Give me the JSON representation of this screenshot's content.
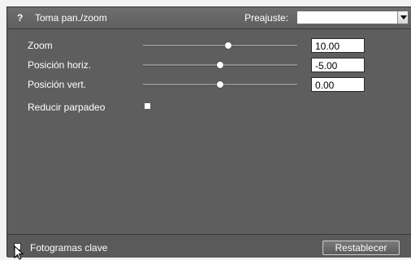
{
  "header": {
    "help_icon": "?",
    "title": "Toma pan./zoom",
    "preset_label": "Preajuste:",
    "preset_value": ""
  },
  "params": [
    {
      "label": "Zoom",
      "value": "10.00",
      "slider_level": 0.55
    },
    {
      "label": "Posición horiz.",
      "value": "-5.00",
      "slider_level": 0.5
    },
    {
      "label": "Posición vert.",
      "value": "0.00",
      "slider_level": 0.5
    }
  ],
  "flicker": {
    "label": "Reducir parpadeo"
  },
  "footer": {
    "keyframes_label": "Fotogramas clave",
    "reset_label": "Restablecer"
  },
  "colors": {
    "panel_bg": "#5e5e5e",
    "header_bg": "#666666",
    "text": "#ffffff",
    "input_bg": "#ffffff"
  }
}
